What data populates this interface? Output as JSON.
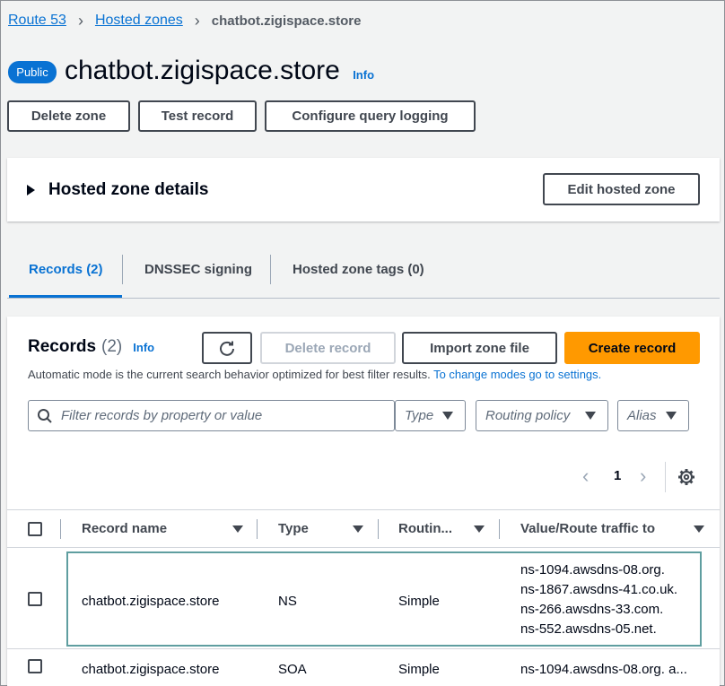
{
  "breadcrumb": {
    "root": "Route 53",
    "parent": "Hosted zones",
    "current": "chatbot.zigispace.store"
  },
  "header": {
    "badge": "Public",
    "title": "chatbot.zigispace.store",
    "info": "Info"
  },
  "actions": {
    "delete_zone": "Delete zone",
    "test_record": "Test record",
    "configure_logging": "Configure query logging"
  },
  "details": {
    "title": "Hosted zone details",
    "edit": "Edit hosted zone"
  },
  "tabs": [
    {
      "label": "Records (2)"
    },
    {
      "label": "DNSSEC signing"
    },
    {
      "label": "Hosted zone tags (0)"
    }
  ],
  "records": {
    "title": "Records",
    "count": "(2)",
    "info": "Info",
    "delete": "Delete record",
    "import": "Import zone file",
    "create": "Create record",
    "mode_text": "Automatic mode is the current search behavior optimized for best filter results.",
    "mode_link": "To change modes go to settings.",
    "search_placeholder": "Filter records by property or value",
    "filter_type": "Type",
    "filter_routing": "Routing policy",
    "filter_alias": "Alias",
    "page": "1",
    "columns": {
      "name": "Record name",
      "type": "Type",
      "routing": "Routin...",
      "value": "Value/Route traffic to"
    },
    "rows": [
      {
        "name": "chatbot.zigispace.store",
        "type": "NS",
        "routing": "Simple",
        "values": [
          "ns-1094.awsdns-08.org.",
          "ns-1867.awsdns-41.co.uk.",
          "ns-266.awsdns-33.com.",
          "ns-552.awsdns-05.net."
        ]
      },
      {
        "name": "chatbot.zigispace.store",
        "type": "SOA",
        "routing": "Simple",
        "value": "ns-1094.awsdns-08.org. a..."
      }
    ]
  },
  "colors": {
    "link": "#0972d3",
    "primary": "#ff9900",
    "badge": "#0972d3"
  }
}
